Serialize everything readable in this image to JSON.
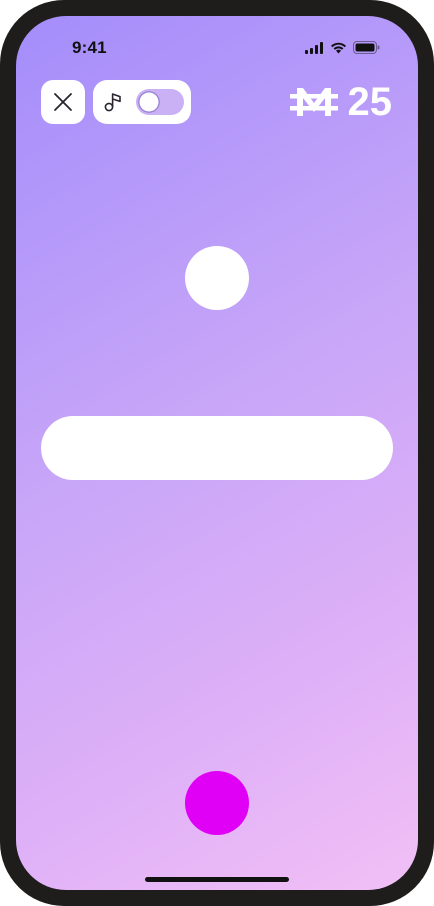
{
  "status_bar": {
    "time": "9:41",
    "icons": [
      "signal-icon",
      "wifi-icon",
      "battery-icon"
    ]
  },
  "toolbar": {
    "close_icon": "close-icon",
    "music_icon": "music-note-icon",
    "music_toggle_on": false
  },
  "score": {
    "currency_icon": "m-coin-icon",
    "value": "25"
  },
  "game": {
    "action_button_color": "#e000f5"
  },
  "colors": {
    "background_start": "#a48dfb",
    "background_end": "#f2c0f6",
    "accent": "#e000f5"
  }
}
